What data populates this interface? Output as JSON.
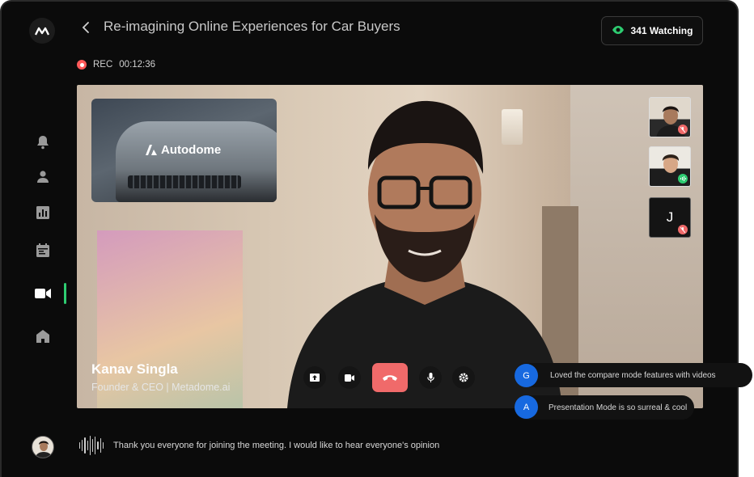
{
  "app": {
    "logo_icon": "metadome-logo-icon",
    "accent_color": "#2ecc71",
    "end_call_color": "#f06a6a",
    "rec_color": "#ff5a5a"
  },
  "sidebar": {
    "items": [
      {
        "icon": "bell-icon",
        "active": false
      },
      {
        "icon": "user-icon",
        "active": false
      },
      {
        "icon": "chart-icon",
        "active": false
      },
      {
        "icon": "calendar-icon",
        "active": false
      },
      {
        "icon": "video-camera-icon",
        "active": true
      },
      {
        "icon": "home-icon",
        "active": false
      }
    ]
  },
  "header": {
    "title": "Re-imagining Online Experiences for Car Buyers",
    "watching_label": "341 Watching"
  },
  "recording": {
    "label": "REC",
    "time": "00:12:36"
  },
  "stage": {
    "brand_name": "Autodome",
    "speaker_name": "Kanav Singla",
    "speaker_role": "Founder & CEO | Metadome.ai",
    "participants": [
      {
        "initial": "",
        "muted": true
      },
      {
        "initial": "",
        "muted": false
      },
      {
        "initial": "J",
        "muted": true
      }
    ]
  },
  "controls": {
    "share_icon": "share-screen-icon",
    "camera_icon": "camera-icon",
    "end_icon": "end-call-icon",
    "mic_icon": "microphone-icon",
    "settings_icon": "settings-icon"
  },
  "chat": [
    {
      "initial": "G",
      "message": "Loved the compare mode features with videos"
    },
    {
      "initial": "A",
      "message": "Presentation Mode is so surreal & cool"
    }
  ],
  "transcript": {
    "caption": "Thank you everyone for joining the meeting. I would like to hear everyone's opinion"
  }
}
